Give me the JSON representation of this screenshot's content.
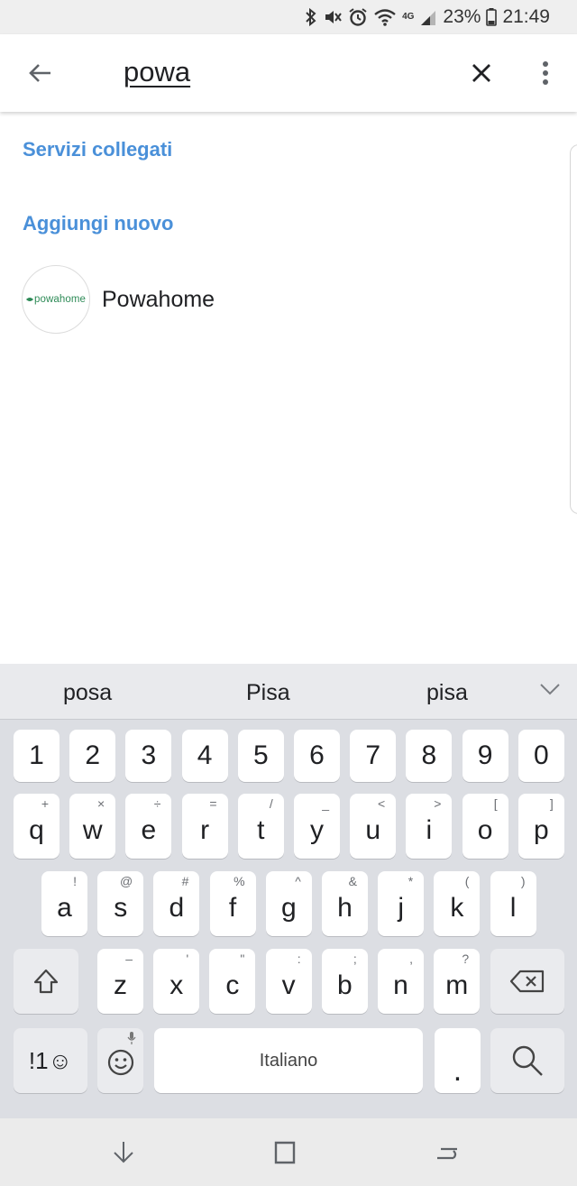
{
  "status_bar": {
    "battery": "23%",
    "time": "21:49",
    "network": "4G",
    "icons": [
      "bluetooth-icon",
      "mute-icon",
      "alarm-icon",
      "wifi-icon",
      "signal-icon",
      "battery-icon"
    ]
  },
  "app_bar": {
    "search_query": "powa",
    "icons": [
      "back-arrow-icon",
      "close-icon",
      "more-vert-icon"
    ]
  },
  "content": {
    "linked_services_heading": "Servizi collegati",
    "add_new_heading": "Aggiungi nuovo",
    "services": [
      {
        "logo_text": "powahome",
        "name": "Powahome"
      }
    ],
    "accent_color": "#4a90d9",
    "logo_color": "#2e8b57"
  },
  "keyboard": {
    "suggestions": [
      "posa",
      "Pisa",
      "pisa"
    ],
    "number_row": [
      "1",
      "2",
      "3",
      "4",
      "5",
      "6",
      "7",
      "8",
      "9",
      "0"
    ],
    "row1": [
      {
        "k": "q",
        "s": "+"
      },
      {
        "k": "w",
        "s": "×"
      },
      {
        "k": "e",
        "s": "÷"
      },
      {
        "k": "r",
        "s": "="
      },
      {
        "k": "t",
        "s": "/"
      },
      {
        "k": "y",
        "s": "_"
      },
      {
        "k": "u",
        "s": "<"
      },
      {
        "k": "i",
        "s": ">"
      },
      {
        "k": "o",
        "s": "["
      },
      {
        "k": "p",
        "s": "]"
      }
    ],
    "row2": [
      {
        "k": "a",
        "s": "!"
      },
      {
        "k": "s",
        "s": "@"
      },
      {
        "k": "d",
        "s": "#"
      },
      {
        "k": "f",
        "s": "%"
      },
      {
        "k": "g",
        "s": "^"
      },
      {
        "k": "h",
        "s": "&"
      },
      {
        "k": "j",
        "s": "*"
      },
      {
        "k": "k",
        "s": "("
      },
      {
        "k": "l",
        "s": ")"
      }
    ],
    "row3": [
      {
        "k": "z",
        "s": "–"
      },
      {
        "k": "x",
        "s": "'"
      },
      {
        "k": "c",
        "s": "\""
      },
      {
        "k": "v",
        "s": ":"
      },
      {
        "k": "b",
        "s": ";"
      },
      {
        "k": "n",
        "s": ","
      },
      {
        "k": "m",
        "s": "?"
      }
    ],
    "symbols_key": "!1☺",
    "space_label": "Italiano",
    "period": "."
  }
}
